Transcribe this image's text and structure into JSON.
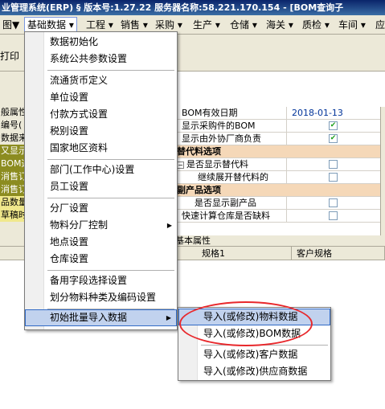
{
  "window": {
    "title": "业管理系统(ERP) § 版本号:1.27.22  服务器名称:58.221.170.154 - [BOM查询子"
  },
  "menubar": {
    "items": [
      {
        "label": "图▼"
      },
      {
        "label": "基础数据 ▾"
      },
      {
        "label": "工程 ▾"
      },
      {
        "label": "销售 ▾"
      },
      {
        "label": "采购 ▾"
      },
      {
        "label": "生产 ▾"
      },
      {
        "label": "仓储 ▾"
      },
      {
        "label": "海关 ▾"
      },
      {
        "label": "质检 ▾"
      },
      {
        "label": "车间 ▾"
      },
      {
        "label": "应"
      }
    ]
  },
  "toolbar": {
    "print_label": "打印"
  },
  "left_column": {
    "rows": [
      "般属性",
      "编号(",
      "数据来",
      "又显示",
      "BOM选",
      "消售订",
      "消售订",
      "品数量",
      "草稿时"
    ]
  },
  "property_grid": {
    "rows": [
      {
        "label": "BOM有效日期",
        "value": "2018-01-13",
        "type": "date"
      },
      {
        "label": "显示采购件的BOM",
        "checked": true,
        "type": "check"
      },
      {
        "label": "显示由外协厂商负责",
        "checked": true,
        "type": "check"
      },
      {
        "label": "替代料选项",
        "type": "section"
      },
      {
        "label": "是否显示替代料",
        "checked": false,
        "type": "check",
        "expander": "−"
      },
      {
        "label": "继续展开替代料的",
        "checked": false,
        "type": "check"
      },
      {
        "label": "副产品选项",
        "type": "section"
      },
      {
        "label": "是否显示副产品",
        "checked": false,
        "type": "check"
      },
      {
        "label": "快速计算仓库是否缺料",
        "checked": false,
        "type": "check"
      }
    ]
  },
  "bottom": {
    "band_title": "基本属性",
    "columns": [
      "规格1",
      "客户规格"
    ]
  },
  "dropdown": {
    "items": [
      {
        "label": "数据初始化"
      },
      {
        "label": "系统公共参数设置"
      },
      {
        "label": "流通货币定义"
      },
      {
        "label": "单位设置"
      },
      {
        "label": "付款方式设置"
      },
      {
        "label": "税别设置"
      },
      {
        "label": "国家地区资料"
      },
      {
        "label": "部门(工作中心)设置"
      },
      {
        "label": "员工设置"
      },
      {
        "label": "分厂设置"
      },
      {
        "label": "物料分厂控制",
        "submenu": true
      },
      {
        "label": "地点设置"
      },
      {
        "label": "仓库设置"
      },
      {
        "label": "备用字段选择设置"
      },
      {
        "label": "划分物料种类及编码设置"
      },
      {
        "label": "初始批量导入数据",
        "submenu": true,
        "highlighted": true
      }
    ]
  },
  "submenu": {
    "items": [
      {
        "label": "导入(或修改)物料数据",
        "highlighted": true
      },
      {
        "label": "导入(或修改)BOM数据"
      },
      {
        "label": "导入(或修改)客户数据"
      },
      {
        "label": "导入(或修改)供应商数据"
      }
    ]
  },
  "icons": {
    "submenu_arrow": "▶",
    "checkmark": "✔"
  },
  "colors": {
    "highlight_bg": "#c1d2ee",
    "highlight_border": "#316ac5",
    "annotation_red": "#e8282c",
    "section_bg": "#f5d8b8"
  }
}
